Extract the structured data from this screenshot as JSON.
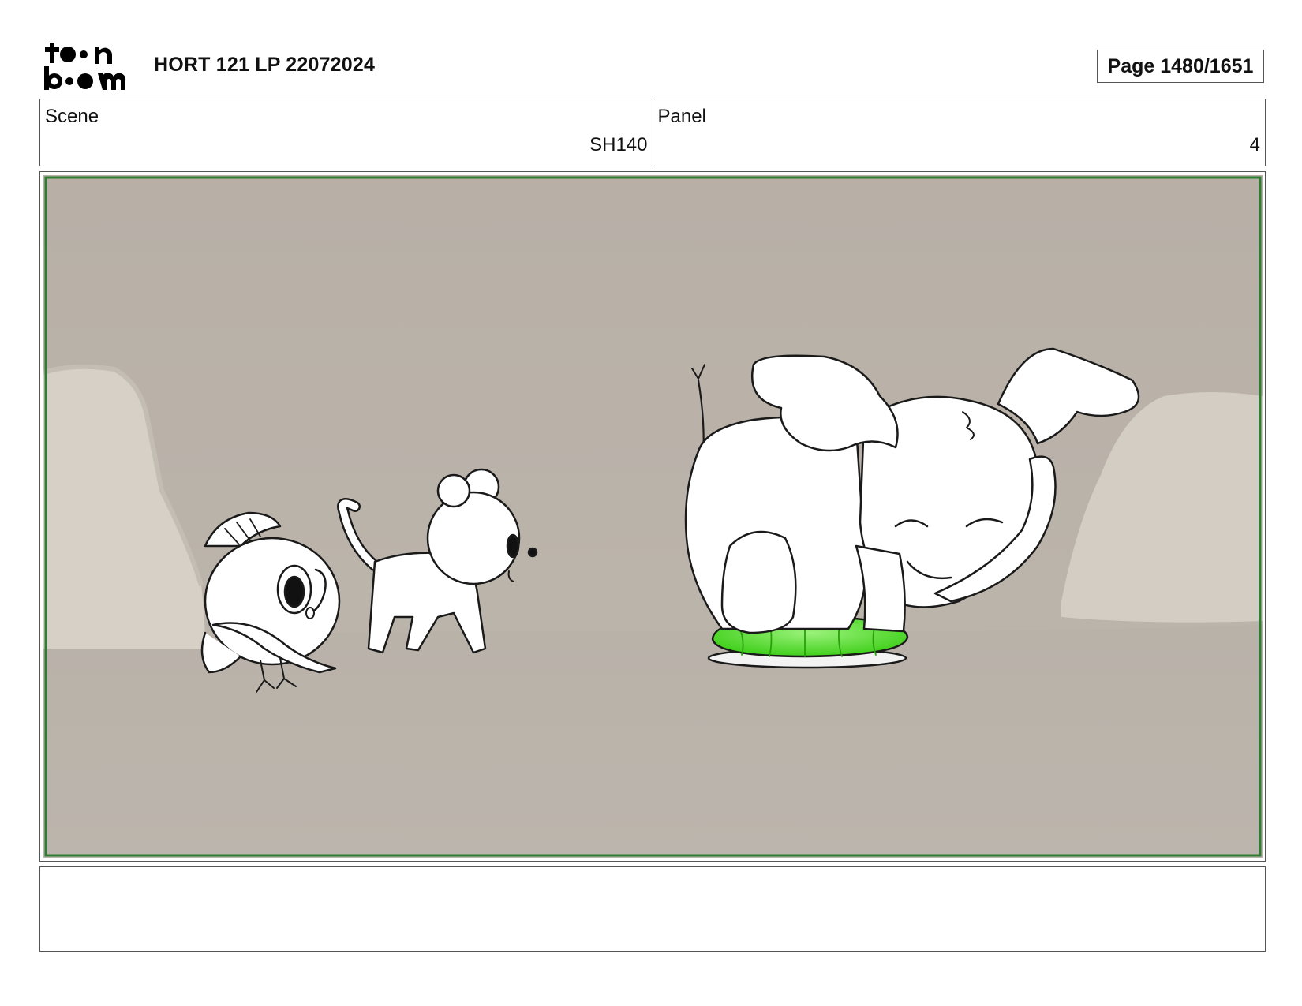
{
  "header": {
    "logo": {
      "line1": "toon",
      "line2": "boom"
    },
    "title": "HORT 121 LP 22072024",
    "page_label": "Page 1480/1651"
  },
  "info": {
    "scene_label": "Scene",
    "scene_value": "SH140",
    "panel_label": "Panel",
    "panel_value": "4"
  },
  "panel": {
    "frame_color": "#2e7d32",
    "background_color": "#bab3aa",
    "characters": [
      "bird-character",
      "bear-cub-character",
      "elephant-character"
    ],
    "prop": "green-cushion"
  },
  "notes": {
    "text": ""
  }
}
